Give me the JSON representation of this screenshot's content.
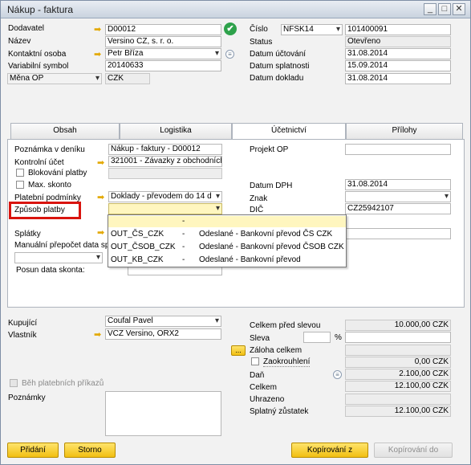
{
  "window": {
    "title": "Nákup - faktura"
  },
  "header_left": {
    "dodavatel_label": "Dodavatel",
    "dodavatel_value": "D00012",
    "nazev_label": "Název",
    "nazev_value": "Versino CZ, s. r. o.",
    "kontakt_label": "Kontaktní osoba",
    "kontakt_value": "Petr Bříza",
    "varsym_label": "Variabilní symbol",
    "varsym_value": "20140633",
    "mena_label": "Měna OP",
    "mena_value": "CZK"
  },
  "header_right": {
    "cislo_label": "Číslo",
    "series_value": "NFSK14",
    "cislo_value": "101400091",
    "status_label": "Status",
    "status_value": "Otevřeno",
    "datum_uctovani_label": "Datum účtování",
    "datum_uctovani_value": "31.08.2014",
    "datum_splatnosti_label": "Datum splatnosti",
    "datum_splatnosti_value": "15.09.2014",
    "datum_dokladu_label": "Datum dokladu",
    "datum_dokladu_value": "31.08.2014"
  },
  "tabs": [
    {
      "label": "Obsah"
    },
    {
      "label": "Logistika"
    },
    {
      "label": "Účetnictví"
    },
    {
      "label": "Přílohy"
    }
  ],
  "accounting": {
    "poznamka_label": "Poznámka v deníku",
    "poznamka_value": "Nákup - faktury - D00012",
    "kontrolni_label": "Kontrolní účet",
    "kontrolni_value": "321001 - Závazky z obchodních",
    "blokovani_label": "Blokování platby",
    "max_skonto_label": "Max. skonto",
    "platebni_label": "Platební podmínky",
    "platebni_value": "Doklady - převodem do 14 d",
    "zpusob_label": "Způsob platby",
    "splatky_label": "Splátky",
    "manualni_label": "Manuální přepočet data sp",
    "posun_label": "Posun data skonta:",
    "projekt_label": "Projekt OP",
    "datum_dph_label": "Datum DPH",
    "datum_dph_value": "31.08.2014",
    "znak_label": "Znak",
    "dic_label": "DIČ",
    "dic_value": "CZ25942107"
  },
  "dropdown": {
    "rows": [
      {
        "code": "",
        "dash": "-",
        "desc": ""
      },
      {
        "code": "OUT_ČS_CZK",
        "dash": "-",
        "desc": "Odeslané - Bankovní převod ČS CZK"
      },
      {
        "code": "OUT_ČSOB_CZK",
        "dash": "-",
        "desc": "Odeslané - Bankovní převod ČSOB CZK"
      },
      {
        "code": "OUT_KB_CZK",
        "dash": "-",
        "desc": "Odeslané - Bankovní převod"
      }
    ]
  },
  "footer_left": {
    "kupujici_label": "Kupující",
    "kupujici_value": "Coufal Pavel",
    "vlastnik_label": "Vlastník",
    "vlastnik_value": "VCZ Versino, ORX2",
    "beh_label": "Běh platebních příkazů",
    "poznamky_label": "Poznámky"
  },
  "totals": {
    "celkem_pred_label": "Celkem před slevou",
    "celkem_pred_value": "10.000,00 CZK",
    "sleva_label": "Sleva",
    "sleva_pct": "%",
    "zaloha_button": "...",
    "zaloha_label": "Záloha celkem",
    "zaokrouhleni_label": "Zaokrouhlení",
    "zaokrouhleni_value": "0,00 CZK",
    "dan_label": "Daň",
    "dan_value": "2.100,00 CZK",
    "celkem_label": "Celkem",
    "celkem_value": "12.100,00 CZK",
    "uhrazeno_label": "Uhrazeno",
    "splatny_label": "Splatný zůstatek",
    "splatny_value": "12.100,00 CZK"
  },
  "buttons": {
    "pridani": "Přidání",
    "storno": "Storno",
    "kopirovani_z": "Kopírování z",
    "kopirovani_do": "Kopírování do"
  },
  "icons": {
    "arrow": "➡",
    "check": "✔",
    "info": "≡"
  },
  "colors": {
    "highlight_border": "#d9140e",
    "button_yellow": "#f1bf12"
  }
}
